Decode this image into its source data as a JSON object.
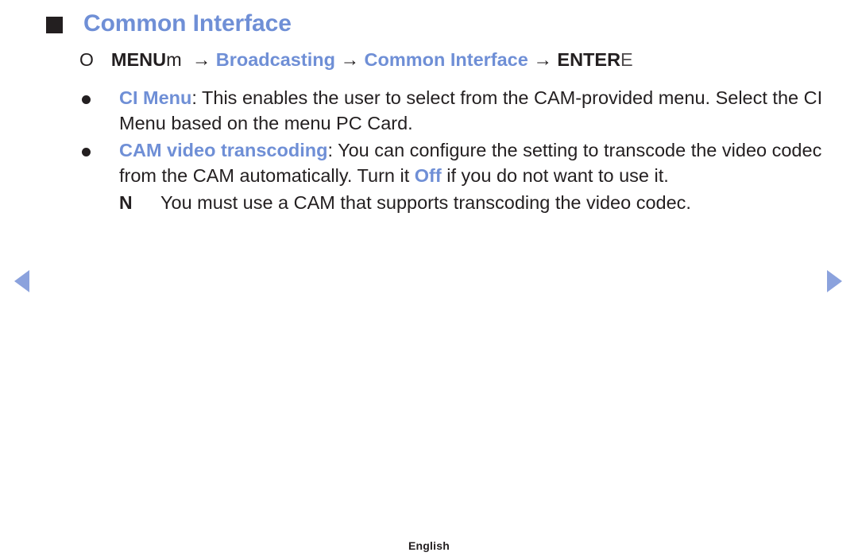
{
  "page": {
    "background_color": "#ffffff",
    "accent_color": "#6f8fd6",
    "text_color": "#231f20",
    "pager_color": "#8ba2dd"
  },
  "heading": {
    "marker": "filled-square",
    "title": "Common Interface"
  },
  "menu_path": {
    "lead_glyph": "O",
    "menu_label": "MENU",
    "menu_suffix": "m",
    "arrow": "→",
    "step_1": "Broadcasting",
    "step_2": "Common Interface",
    "enter_label": "ENTER",
    "enter_suffix": "E"
  },
  "bullets": [
    {
      "marker": "round-dot",
      "keyword": "CI Menu",
      "after_keyword": ": This enables the user to select from the CAM-provided menu. Select the CI Menu based on the menu PC Card."
    },
    {
      "marker": "round-dot",
      "keyword": "CAM video transcoding",
      "segment_1": ": You can configure the setting to transcode the video codec from the CAM automatically. Turn it ",
      "inline_keyword": "Off",
      "segment_2": " if you do not want to use it."
    }
  ],
  "note": {
    "glyph": "N",
    "text": "You must use a CAM that supports transcoding the video codec."
  },
  "pager": {
    "prev_label": "◀",
    "next_label": "▶"
  },
  "footer": {
    "language": "English"
  }
}
